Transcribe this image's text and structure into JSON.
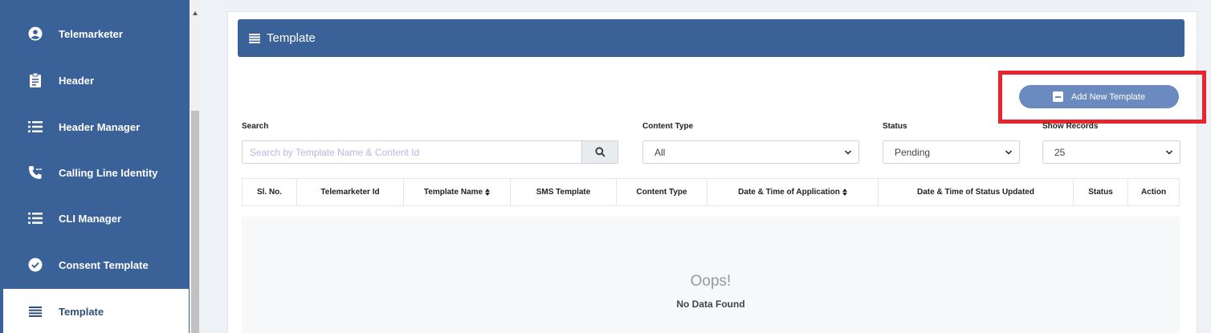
{
  "sidebar": {
    "items": [
      {
        "label": "Telemarketer",
        "icon": "user-circle-icon"
      },
      {
        "label": "Header",
        "icon": "clipboard-icon"
      },
      {
        "label": "Header Manager",
        "icon": "list-icon"
      },
      {
        "label": "Calling Line Identity",
        "icon": "phone-icon"
      },
      {
        "label": "CLI Manager",
        "icon": "list-icon"
      },
      {
        "label": "Consent Template",
        "icon": "check-circle-icon"
      },
      {
        "label": "Template",
        "icon": "hamburger-icon",
        "active": true
      }
    ]
  },
  "page": {
    "title": "Template",
    "add_button_label": "Add New Template"
  },
  "filters": {
    "search_label": "Search",
    "search_placeholder": "Search by Template Name & Content Id",
    "search_value": "",
    "content_type_label": "Content Type",
    "content_type_value": "All",
    "status_label": "Status",
    "status_value": "Pending",
    "show_records_label": "Show Records",
    "show_records_value": "25"
  },
  "table": {
    "columns": [
      "Sl. No.",
      "Telemarketer Id",
      "Template Name",
      "SMS Template",
      "Content Type",
      "Date & Time of Application",
      "Date & Time of Status Updated",
      "Status",
      "Action"
    ],
    "empty_title": "Oops!",
    "empty_message": "No Data Found"
  },
  "colors": {
    "sidebar_bg": "#3a6298",
    "header_bg": "#3a6298",
    "button_bg": "#6b8ac0",
    "highlight": "#e8252d"
  }
}
